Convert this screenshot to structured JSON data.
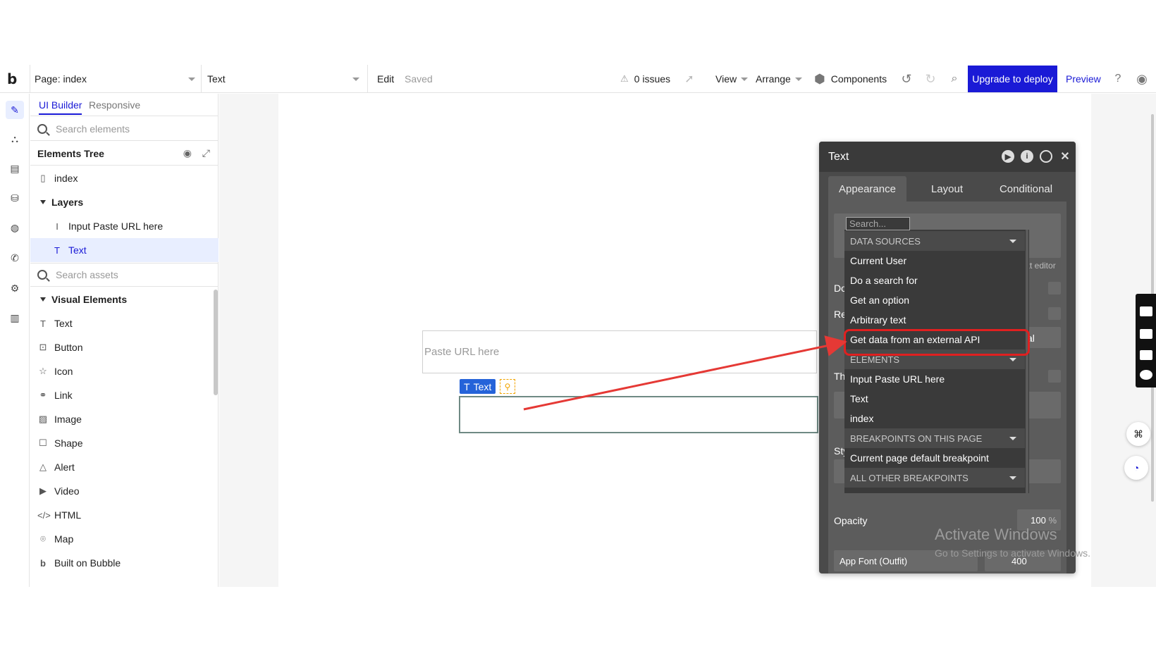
{
  "topbar": {
    "logo": "b",
    "page_label": "Page: index",
    "element_select": "Text",
    "edit": "Edit",
    "saved": "Saved",
    "issues": "0 issues",
    "view": "View",
    "arrange": "Arrange",
    "components": "Components",
    "upgrade": "Upgrade to deploy",
    "preview": "Preview"
  },
  "left_panel": {
    "tab_builder": "UI Builder",
    "tab_responsive": "Responsive",
    "search_elements_placeholder": "Search elements",
    "elements_tree": "Elements Tree",
    "tree": {
      "index": "index",
      "layers": "Layers",
      "input": "Input Paste URL here",
      "text": "Text"
    },
    "search_assets_placeholder": "Search assets",
    "visual_elements": "Visual Elements",
    "visual_items": [
      "Text",
      "Button",
      "Icon",
      "Link",
      "Image",
      "Shape",
      "Alert",
      "Video",
      "HTML",
      "Map",
      "Built on Bubble"
    ]
  },
  "canvas": {
    "input_placeholder": "Paste URL here",
    "text_tag": "Text"
  },
  "editor": {
    "title": "Text",
    "tabs": [
      "Appearance",
      "Layout",
      "Conditional"
    ],
    "opacity_label": "Opacity",
    "opacity_value": "100",
    "opacity_unit": "%",
    "font": "App Font (Outfit)",
    "font_weight": "400",
    "partial_text_editor": "xt editor",
    "partial_do": "Do",
    "partial_re": "Re",
    "partial_th": "Th",
    "partial_sty": "Sty",
    "partial_al": "al"
  },
  "dropdown": {
    "search_placeholder": "Search...",
    "data_sources": "DATA SOURCES",
    "current_user": "Current User",
    "do_search": "Do a search for",
    "get_option": "Get an option",
    "arbitrary_text": "Arbitrary text",
    "external_api": "Get data from an external API",
    "elements": "ELEMENTS",
    "el_input": "Input Paste URL here",
    "el_text": "Text",
    "el_index": "index",
    "breakpoints_page": "BREAKPOINTS ON THIS PAGE",
    "current_breakpoint": "Current page default breakpoint",
    "other_breakpoints": "ALL OTHER BREAKPOINTS"
  },
  "watermark": {
    "line1": "Activate Windows",
    "line2": "Go to Settings to activate Windows."
  },
  "colors": {
    "accent": "#1a1ad6",
    "highlight": "#e02020",
    "editor_bg": "#4a4a4a"
  }
}
